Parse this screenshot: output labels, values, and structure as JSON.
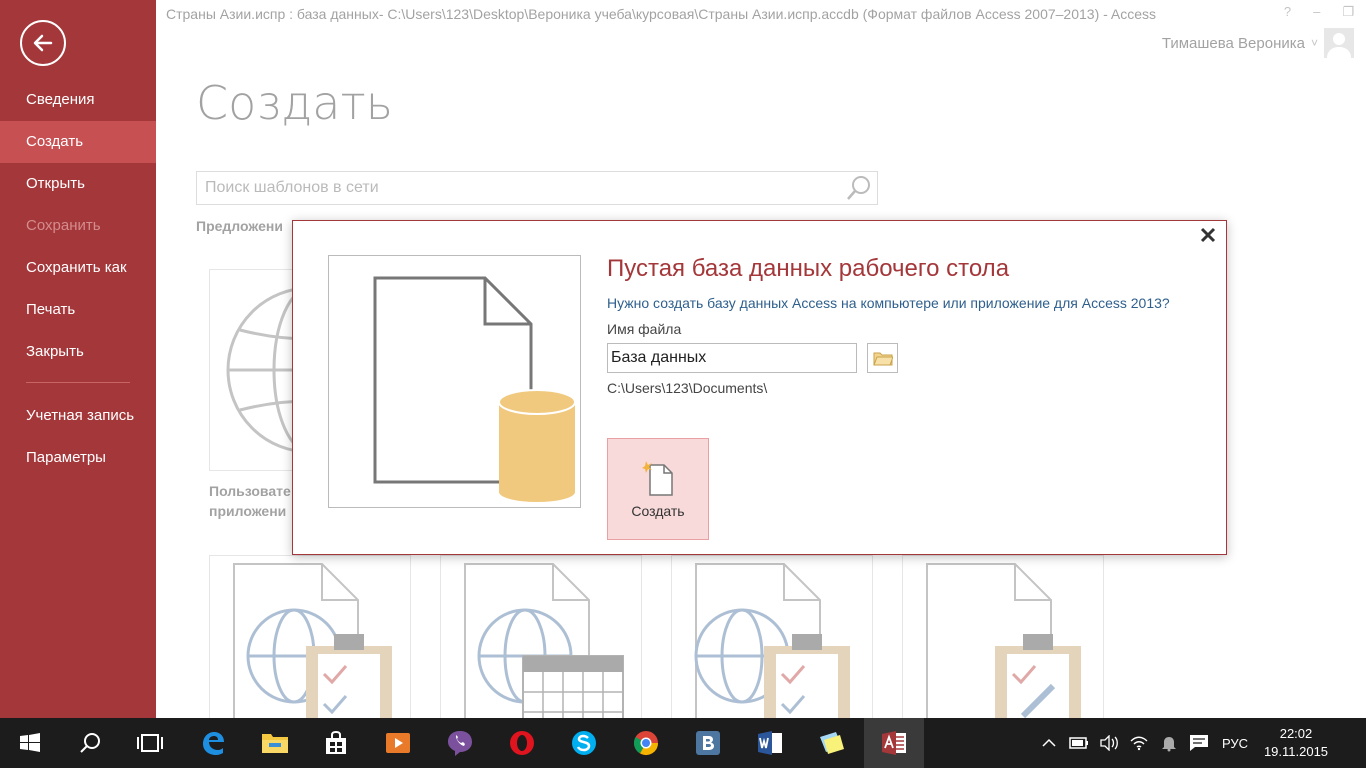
{
  "window": {
    "title": "Страны Азии.испр : база данных- C:\\Users\\123\\Desktop\\Вероника учеба\\курсовая\\Страны Азии.испр.accdb (Формат файлов Access 2007–2013) - Access",
    "help": "?",
    "minimize": "–",
    "restore": "❐",
    "user_name": "Тимашева Вероника",
    "user_chevron": "˅"
  },
  "nav": {
    "items": [
      {
        "label": "Сведения",
        "state": "normal"
      },
      {
        "label": "Создать",
        "state": "active"
      },
      {
        "label": "Открыть",
        "state": "normal"
      },
      {
        "label": "Сохранить",
        "state": "disabled"
      },
      {
        "label": "Сохранить как",
        "state": "normal"
      },
      {
        "label": "Печать",
        "state": "normal"
      },
      {
        "label": "Закрыть",
        "state": "normal"
      },
      {
        "label": "Учетная запись",
        "state": "normal"
      },
      {
        "label": "Параметры",
        "state": "normal"
      }
    ]
  },
  "main": {
    "title": "Создать",
    "search_placeholder": "Поиск шаблонов в сети",
    "suggested_label": "Предложени",
    "template_label_1": "Пользовате",
    "template_label_2": "приложени"
  },
  "dialog": {
    "title": "Пустая база данных рабочего стола",
    "question": "Нужно создать базу данных Access на компьютере или приложение для Access 2013?",
    "filename_label": "Имя файла",
    "filename_value": "База данных",
    "path": "C:\\Users\\123\\Documents\\",
    "create_label": "Создать"
  },
  "taskbar": {
    "lang": "РУС",
    "time": "22:02",
    "date": "19.11.2015"
  },
  "colors": {
    "accent": "#a4373a",
    "accent_light": "#c75052",
    "link": "#2e5f8d",
    "taskbar": "#1c1c1c"
  }
}
